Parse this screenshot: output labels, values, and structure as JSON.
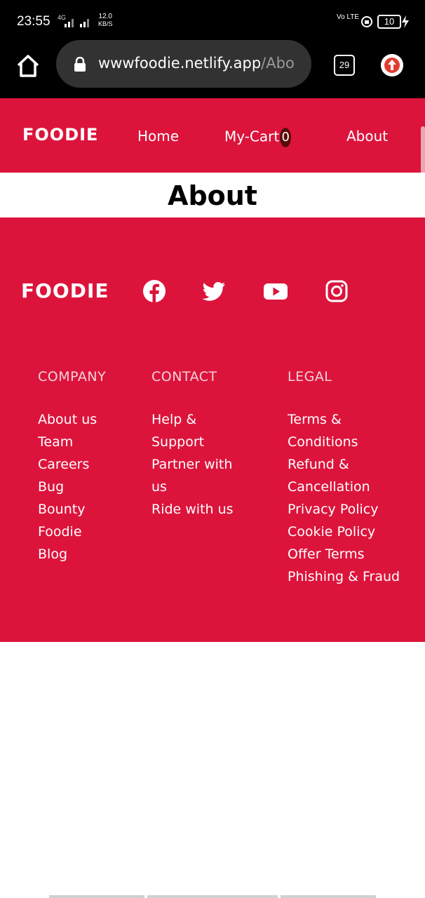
{
  "status_bar": {
    "time": "23:55",
    "network": "4G",
    "speed_value": "12.0",
    "speed_unit": "KB/S",
    "carrier": "Vo LTE",
    "battery": "10"
  },
  "browser": {
    "url_main": "wwwfoodie.netlify.app",
    "url_rest": "/Abo",
    "tab_count": "29"
  },
  "nav": {
    "brand": "FOODIE",
    "home": "Home",
    "cart": "My-Cart",
    "cart_count": "0",
    "about": "About"
  },
  "page": {
    "title": "About"
  },
  "footer": {
    "brand": "FOODIE",
    "social_icons": [
      "facebook-icon",
      "twitter-icon",
      "youtube-icon",
      "instagram-icon"
    ],
    "company": {
      "heading": "COMPANY",
      "items": [
        "About us",
        "Team",
        "Careers",
        "Bug",
        "Bounty",
        "Foodie",
        "Blog"
      ]
    },
    "contact": {
      "heading": "CONTACT",
      "items": [
        "Help &",
        "Support",
        "Partner with",
        "us",
        "Ride with us"
      ]
    },
    "legal": {
      "heading": "LEGAL",
      "items": [
        "Terms &",
        "Conditions",
        "Refund &",
        "Cancellation",
        "Privacy Policy",
        "Cookie Policy",
        "Offer Terms",
        "Phishing & Fraud"
      ]
    }
  },
  "colors": {
    "brand_red": "#dc143c",
    "black": "#000000",
    "white": "#ffffff"
  }
}
